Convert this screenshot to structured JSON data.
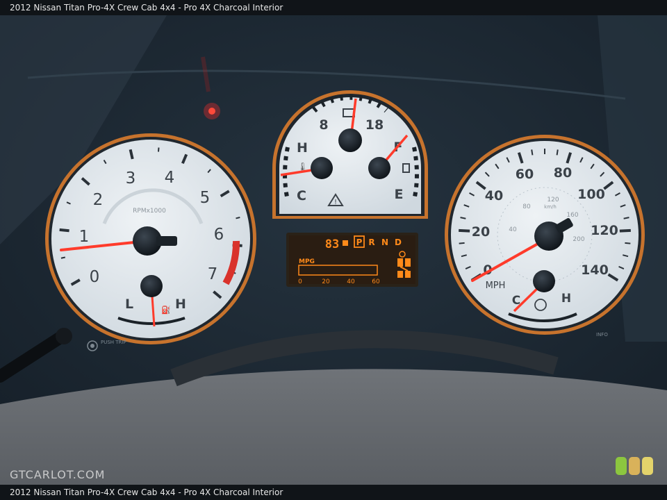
{
  "caption": "2012 Nissan Titan Pro-4X Crew Cab 4x4 - Pro 4X Charcoal Interior",
  "watermark": "GTCARLOT.COM",
  "tachometer": {
    "numbers": [
      "0",
      "1",
      "2",
      "3",
      "4",
      "5",
      "6",
      "7"
    ],
    "unit_label": "RPMx1000",
    "sub_gauge": {
      "low": "L",
      "high": "H"
    }
  },
  "center_gauge": {
    "volt_low": "8",
    "volt_high": "18",
    "temp_high": "H",
    "temp_low": "C",
    "fuel_full": "F",
    "fuel_empty": "E"
  },
  "display": {
    "odometer": "83",
    "gears": [
      "P",
      "R",
      "N",
      "D"
    ],
    "mpg_label": "MPG",
    "mpg_scale": [
      "0",
      "20",
      "40",
      "60"
    ]
  },
  "speedometer": {
    "mph_numbers": [
      "0",
      "20",
      "40",
      "60",
      "80",
      "100",
      "120",
      "140"
    ],
    "kmh_numbers": [
      "40",
      "80",
      "120",
      "160",
      "200"
    ],
    "kmh_unit": "km/h",
    "unit": "MPH",
    "temp_low": "C",
    "temp_high": "H"
  },
  "controls": {
    "push_trip": "PUSH TRIP",
    "info": "INFO"
  },
  "colors": {
    "needle": "#ff3b2b",
    "display_text": "#ff8a1a",
    "bezel": "#c7732d",
    "dial_face": "#dfe6ec"
  }
}
